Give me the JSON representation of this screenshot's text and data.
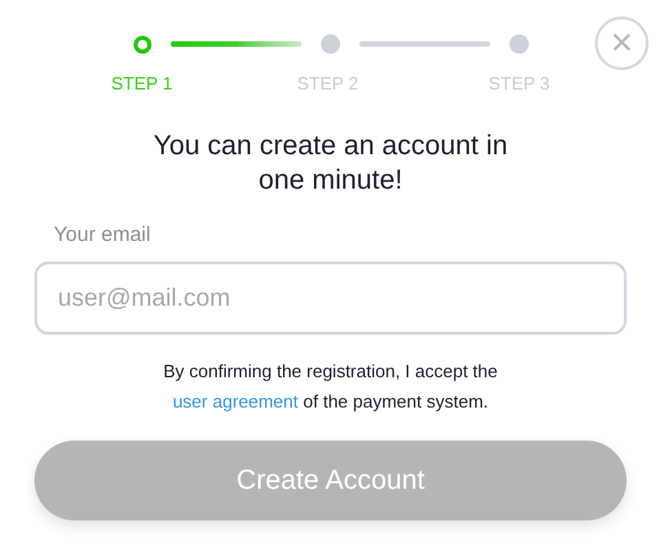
{
  "steps": [
    {
      "label": "STEP 1",
      "selected": true
    },
    {
      "label": "STEP 2",
      "selected": false
    },
    {
      "label": "STEP 3",
      "selected": false
    }
  ],
  "close_label": "×",
  "heading": "You can create an account in one minute!",
  "email": {
    "label": "Your email",
    "placeholder": "user@mail.com"
  },
  "consent": {
    "before": "By confirming the registration, I accept the ",
    "link": "user agreement",
    "after": " of the payment system."
  },
  "submit": {
    "label": "Create Account",
    "disabled": true
  }
}
